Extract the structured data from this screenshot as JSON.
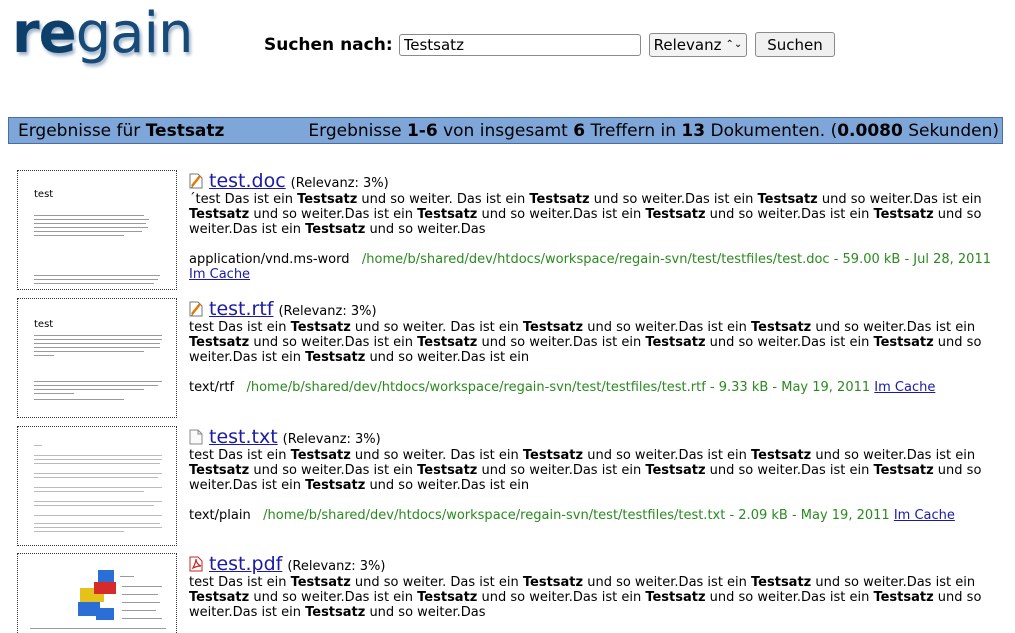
{
  "logo": {
    "part1": "re",
    "part2": "gain"
  },
  "search": {
    "label": "Suchen nach:",
    "value": "Testsatz",
    "sort": "Relevanz",
    "button": "Suchen"
  },
  "bar": {
    "left_prefix": "Ergebnisse für ",
    "query": "Testsatz",
    "right": {
      "p1": "Ergebnisse ",
      "range": "1-6",
      "p2": " von insgesamt ",
      "total": "6",
      "p3": " Treffern in ",
      "docs": "13",
      "p4": " Dokumenten. (",
      "time": "0.0080",
      "p5": " Sekunden)"
    }
  },
  "cache_label": "Im Cache",
  "results": [
    {
      "title": "test.doc",
      "relevance": "(Relevanz: 3%)",
      "icon": "word-document-icon",
      "summary": [
        {
          "t": "´test Das ist ein "
        },
        {
          "b": "Testsatz"
        },
        {
          "t": " und so weiter. Das ist ein "
        },
        {
          "b": "Testsatz"
        },
        {
          "t": " und so weiter.Das ist ein "
        },
        {
          "b": "Testsatz"
        },
        {
          "t": " und so weiter.Das ist ein "
        },
        {
          "b": "Testsatz"
        },
        {
          "t": " und so weiter.Das ist ein "
        },
        {
          "b": "Testsatz"
        },
        {
          "t": " und so weiter.Das ist ein "
        },
        {
          "b": "Testsatz"
        },
        {
          "t": " und so weiter.Das ist ein "
        },
        {
          "b": "Testsatz"
        },
        {
          "t": " und so weiter.Das ist ein "
        },
        {
          "b": "Testsatz"
        },
        {
          "t": " und so weiter.Das"
        }
      ],
      "mime": "application/vnd.ms-word",
      "path": "/home/b/shared/dev/htdocs/workspace/regain-svn/test/testfiles/test.doc - 59.00 kB - Jul 28, 2011"
    },
    {
      "title": "test.rtf",
      "relevance": "(Relevanz: 3%)",
      "icon": "rtf-document-icon",
      "summary": [
        {
          "t": "test Das ist ein "
        },
        {
          "b": "Testsatz"
        },
        {
          "t": " und so weiter. Das ist ein "
        },
        {
          "b": "Testsatz"
        },
        {
          "t": " und so weiter.Das ist ein "
        },
        {
          "b": "Testsatz"
        },
        {
          "t": " und so weiter.Das ist ein "
        },
        {
          "b": "Testsatz"
        },
        {
          "t": " und so weiter.Das ist ein "
        },
        {
          "b": "Testsatz"
        },
        {
          "t": " und so weiter.Das ist ein "
        },
        {
          "b": "Testsatz"
        },
        {
          "t": " und so weiter.Das ist ein "
        },
        {
          "b": "Testsatz"
        },
        {
          "t": " und so weiter.Das ist ein "
        },
        {
          "b": "Testsatz"
        },
        {
          "t": " und so weiter.Das ist ein"
        }
      ],
      "mime": "text/rtf",
      "path": "/home/b/shared/dev/htdocs/workspace/regain-svn/test/testfiles/test.rtf - 9.33 kB - May 19, 2011"
    },
    {
      "title": "test.txt",
      "relevance": "(Relevanz: 3%)",
      "icon": "text-document-icon",
      "summary": [
        {
          "t": "test Das ist ein "
        },
        {
          "b": "Testsatz"
        },
        {
          "t": " und so weiter. Das ist ein "
        },
        {
          "b": "Testsatz"
        },
        {
          "t": " und so weiter.Das ist ein "
        },
        {
          "b": "Testsatz"
        },
        {
          "t": " und so weiter.Das ist ein "
        },
        {
          "b": "Testsatz"
        },
        {
          "t": " und so weiter.Das ist ein "
        },
        {
          "b": "Testsatz"
        },
        {
          "t": " und so weiter.Das ist ein "
        },
        {
          "b": "Testsatz"
        },
        {
          "t": " und so weiter.Das ist ein "
        },
        {
          "b": "Testsatz"
        },
        {
          "t": " und so weiter.Das ist ein "
        },
        {
          "b": "Testsatz"
        },
        {
          "t": " und so weiter.Das ist ein"
        }
      ],
      "mime": "text/plain",
      "path": "/home/b/shared/dev/htdocs/workspace/regain-svn/test/testfiles/test.txt - 2.09 kB - May 19, 2011"
    },
    {
      "title": "test.pdf",
      "relevance": "(Relevanz: 3%)",
      "icon": "pdf-document-icon",
      "summary": [
        {
          "t": "test Das ist ein "
        },
        {
          "b": "Testsatz"
        },
        {
          "t": " und so weiter. Das ist ein "
        },
        {
          "b": "Testsatz"
        },
        {
          "t": " und so weiter.Das ist ein "
        },
        {
          "b": "Testsatz"
        },
        {
          "t": " und so weiter.Das ist ein "
        },
        {
          "b": "Testsatz"
        },
        {
          "t": " und so weiter.Das ist ein "
        },
        {
          "b": "Testsatz"
        },
        {
          "t": " und so weiter.Das ist ein "
        },
        {
          "b": "Testsatz"
        },
        {
          "t": " und so weiter.Das ist ein "
        },
        {
          "b": "Testsatz"
        },
        {
          "t": " und so weiter.Das ist ein "
        },
        {
          "b": "Testsatz"
        },
        {
          "t": " und so weiter.Das"
        }
      ],
      "mime": "",
      "path": ""
    }
  ]
}
